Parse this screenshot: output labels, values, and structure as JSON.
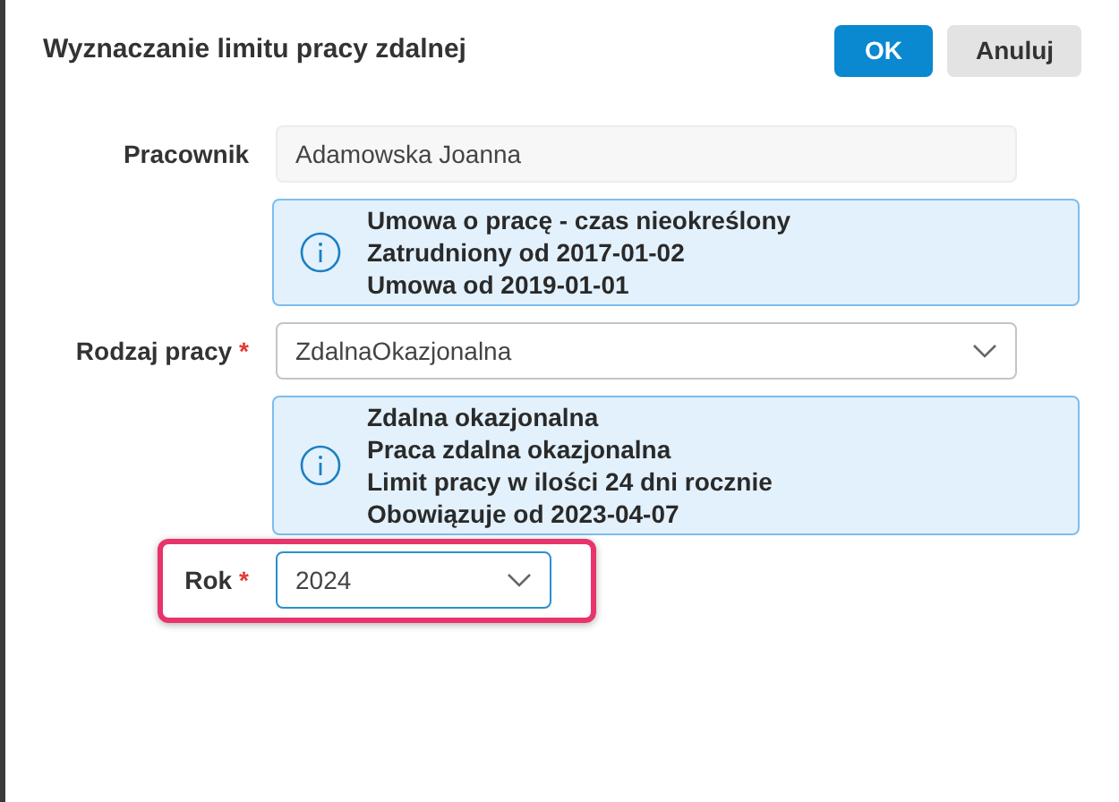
{
  "dialog": {
    "title": "Wyznaczanie limitu pracy zdalnej",
    "buttons": [
      {
        "label": "OK",
        "kind": "primary"
      },
      {
        "label": "Anuluj",
        "kind": "secondary"
      }
    ]
  },
  "fields": [
    {
      "label": "Pracownik",
      "kind": "text",
      "value": "Adamowska Joanna",
      "required": false,
      "readonly": true,
      "focused": false,
      "highlighted": false,
      "info": [
        "Umowa o pracę - czas nieokreślony",
        "Zatrudniony od 2017-01-02",
        "Umowa od 2019-01-01"
      ]
    },
    {
      "label": "Rodzaj pracy",
      "kind": "select",
      "value": "ZdalnaOkazjonalna",
      "required": true,
      "readonly": false,
      "focused": false,
      "highlighted": false,
      "info": [
        "Zdalna okazjonalna",
        "Praca zdalna okazjonalna",
        "Limit pracy w ilości 24 dni rocznie",
        "Obowiązuje od 2023-04-07"
      ]
    },
    {
      "label": "Rok",
      "kind": "select",
      "value": "2024",
      "required": true,
      "readonly": false,
      "focused": true,
      "highlighted": true,
      "required_mark": "*"
    }
  ],
  "required_mark": "*"
}
